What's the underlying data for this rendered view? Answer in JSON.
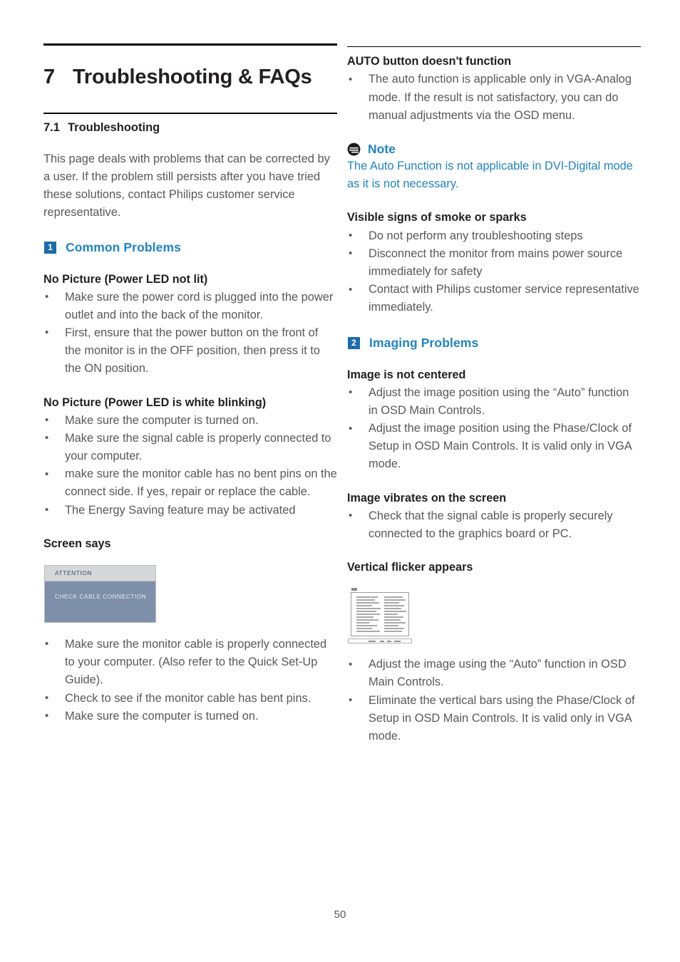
{
  "document": {
    "page_number": "50"
  },
  "left_column": {
    "chapter": {
      "number": "7",
      "title": "Troubleshooting & FAQs"
    },
    "section": {
      "number": "7.1",
      "title": "Troubleshooting"
    },
    "intro_paragraph": "This page deals with problems that can be corrected by a user. If the problem still persists after you have tried these solutions, contact Philips customer service representative.",
    "common_problems": {
      "badge": "1",
      "label": "Common Problems"
    },
    "topics": [
      {
        "heading": "No Picture (Power LED not lit)",
        "bullets": [
          "Make sure the power cord is plugged into the power outlet and into the back of the monitor.",
          "First, ensure that the power button on the front of the monitor is in the OFF position, then press it to the ON position."
        ]
      },
      {
        "heading": "No Picture (Power LED is white blinking)",
        "bullets": [
          "Make sure the computer is turned on.",
          "Make sure the signal cable is properly connected to your computer.",
          "make sure the monitor cable has no bent pins on the connect side. If yes, repair or replace the cable.",
          "The Energy Saving feature may be activated"
        ]
      }
    ],
    "screen_says": {
      "heading": "Screen says",
      "osd": {
        "title": "ATTENTION",
        "message": "CHECK CABLE CONNECTION",
        "title_bar_color": "#d6d7d9",
        "body_color": "#7e8fa9"
      },
      "bullets": [
        "Make sure the monitor cable is properly connected to your computer. (Also refer to the Quick Set-Up Guide).",
        "Check to see if the monitor cable has bent pins.",
        "Make sure the computer is turned on."
      ]
    }
  },
  "right_column": {
    "auto_button": {
      "heading": "AUTO button doesn't function",
      "bullets": [
        "The auto function is applicable only in VGA-Analog mode.  If the result is not satisfactory, you can do manual adjustments via the OSD menu."
      ]
    },
    "note": {
      "title": "Note",
      "body": "The Auto Function is not applicable in DVI-Digital mode as it is not necessary.",
      "color": "#2084c4"
    },
    "smoke": {
      "heading": "Visible signs of smoke or sparks",
      "bullets": [
        "Do not perform any troubleshooting steps",
        "Disconnect the monitor from mains power source immediately for safety",
        "Contact with Philips customer service representative immediately."
      ]
    },
    "imaging_problems": {
      "badge": "2",
      "label": "Imaging Problems"
    },
    "topics": [
      {
        "heading": "Image is not centered",
        "bullets": [
          "Adjust the image position using the “Auto” function in OSD Main Controls.",
          "Adjust the image position using the Phase/Clock of Setup in OSD Main Controls.  It is valid only in VGA mode."
        ]
      },
      {
        "heading": "Image vibrates on the screen",
        "bullets": [
          "Check that the signal cable is properly securely connected to the graphics board or PC."
        ]
      }
    ],
    "vertical_flicker": {
      "heading": "Vertical flicker appears",
      "bullets": [
        "Adjust the image using the “Auto” function in OSD Main Controls.",
        "Eliminate the vertical bars using the Phase/Clock of Setup in OSD Main Controls. It is valid only in VGA mode."
      ]
    }
  },
  "theme": {
    "accent_blue": "#2084c4",
    "badge_blue": "#1b6cab",
    "body_text": "#58585b",
    "heading_text": "#231f20"
  }
}
